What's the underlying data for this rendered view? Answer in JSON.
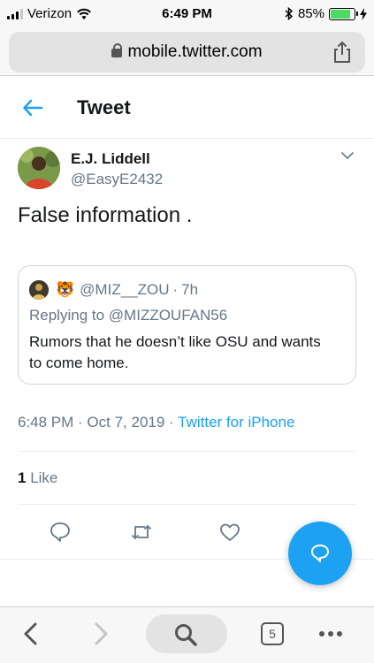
{
  "status_bar": {
    "carrier": "Verizon",
    "time": "6:49 PM",
    "battery": "85%",
    "battery_level": 0.85
  },
  "browser": {
    "url": "mobile.twitter.com",
    "tabs_count": "5"
  },
  "header": {
    "title": "Tweet"
  },
  "tweet": {
    "author_name": "E.J. Liddell",
    "author_handle": "@EasyE2432",
    "text": "False information .",
    "quote": {
      "handle": "@MIZ__ZOU",
      "separator": "·",
      "age": "7h",
      "replying_label": "Replying to",
      "replying_to": "@MIZZOUFAN56",
      "text": "Rumors that he doesn’t like OSU and wants to come home."
    },
    "timestamp": "6:48 PM · Oct 7, 2019 ·",
    "source": "Twitter for iPhone",
    "likes_count": "1",
    "likes_label": "Like"
  },
  "colors": {
    "accent": "#1da1f2",
    "secondary_text": "#657786"
  }
}
